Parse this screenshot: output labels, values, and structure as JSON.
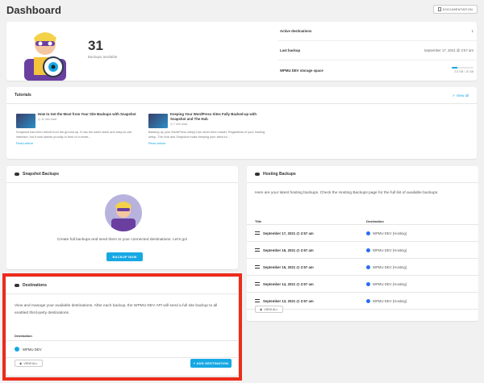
{
  "header": {
    "title": "Dashboard",
    "doc_button": "DOCUMENTATION"
  },
  "summary": {
    "count": "31",
    "count_label": "Backups available",
    "stats": [
      {
        "label": "Active destinations",
        "value": "1"
      },
      {
        "label": "Last backup",
        "value": "September 17, 2021 @ 2:57 am"
      },
      {
        "label": "WPMU DEV storage space",
        "value": ""
      }
    ],
    "storage_text": "2.5 GB / 10 GB",
    "storage_fraction": 0.25
  },
  "tutorials": {
    "title": "Tutorials",
    "view_all": "View all",
    "items": [
      {
        "title": "How to Get the Most from Your Site Backups with Snapshot",
        "meta": "11 min read",
        "excerpt": "Snapshot has been rebuilt from the ground up. It has the same sleek and easy-to-use interface, but it now stands proudly in front of a smart...",
        "read": "Read article"
      },
      {
        "title": "Keeping Your WordPress Sites Fully Backed-up with Snapshot and The Hub",
        "meta": "7 min read",
        "excerpt": "Backing up your WordPress site(s) has never been easier. Regardless of your hosting setup, The Hub and Snapshot make keeping your sites ful...",
        "read": "Read article"
      }
    ]
  },
  "snapshot": {
    "title": "Snapshot Backups",
    "message": "Create full backups and send them to your connected destinations. Let's go!",
    "button": "BACKUP NOW"
  },
  "hosting": {
    "title": "Hosting Backups",
    "description": "Here are your latest hosting backups. Check the Hosting Backups page for the full list of available backups.",
    "col_title": "Title",
    "col_dest": "Destination",
    "rows": [
      {
        "title": "September 17, 2021 @ 2:57 am",
        "dest": "WPMU DEV (Hosting)"
      },
      {
        "title": "September 16, 2021 @ 2:57 am",
        "dest": "WPMU DEV (Hosting)"
      },
      {
        "title": "September 15, 2021 @ 2:57 am",
        "dest": "WPMU DEV (Hosting)"
      },
      {
        "title": "September 14, 2021 @ 2:57 am",
        "dest": "WPMU DEV (Hosting)"
      },
      {
        "title": "September 13, 2021 @ 2:57 am",
        "dest": "WPMU DEV (Hosting)"
      }
    ],
    "view_all": "VIEW ALL"
  },
  "destinations": {
    "title": "Destinations",
    "description": "View and manage your available destinations. After each backup, the WPMU DEV API will send a full site backup to all enabled third-party destinations.",
    "col_dest": "Destination",
    "rows": [
      {
        "name": "WPMU DEV"
      }
    ],
    "view_all": "VIEW ALL",
    "add_button": "ADD DESTINATION"
  },
  "colors": {
    "accent": "#17a8e3",
    "highlight": "#ee2b1c",
    "background": "#f1f1f1"
  }
}
